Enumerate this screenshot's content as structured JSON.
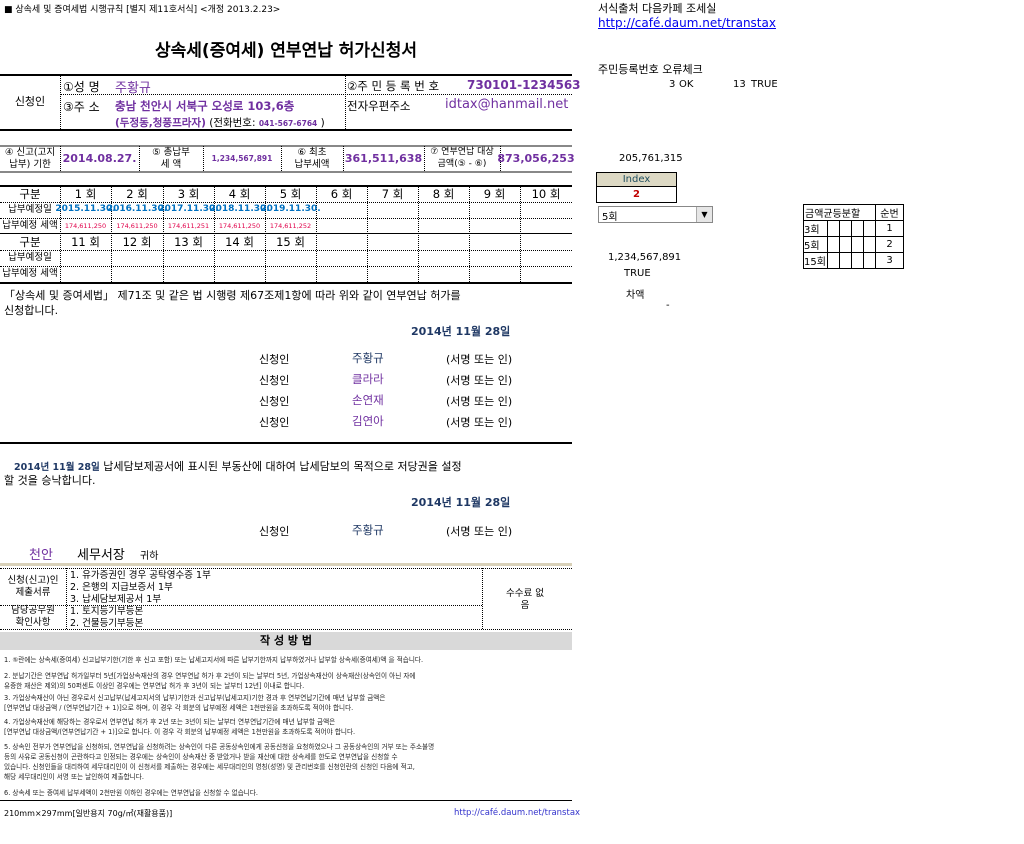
{
  "header": {
    "form_ref": "■ 상속세 및 증여세법 시행규칙 [별지 제11호서식] <개정 2013.2.23>",
    "title": "상속세(증여세) 연부연납 허가신청서"
  },
  "applicant": {
    "section_label": "신청인",
    "name_label": "①성  명",
    "name": "주황규",
    "rrn_label": "②주 민 등 록 번 호",
    "rrn": "730101-1234563",
    "address_label": "③주  소",
    "address1": "충남 천안시 서북구 오성로 103,6층",
    "address2": "(두정동,청풍프라자)",
    "phone_label_open": "(전화번호:",
    "phone": "041-567-6764",
    "phone_close": ")",
    "email_label": "전자우편주소",
    "email": "idtax@hanmail.net"
  },
  "tax": {
    "deadline_label": "④ 신고(고지 납부) 기한",
    "deadline": "2014.08.27.",
    "total_label": "⑤ 총납부 세 액",
    "total": "1,234,567,891",
    "first_label": "⑥ 최초 납부세액",
    "first": "361,511,638",
    "target_label": "⑦ 연부연납 대상금액(⑤ - ⑥)",
    "target": "873,056,253"
  },
  "schedule": {
    "gubun": "구분",
    "date_label": "납부예정일",
    "amount_label": "납부예정 세액",
    "rounds1": [
      "1 회",
      "2 회",
      "3 회",
      "4 회",
      "5 회",
      "6 회",
      "7 회",
      "8 회",
      "9 회",
      "10 회"
    ],
    "dates1": [
      "2015.11.30.",
      "2016.11.30.",
      "2017.11.30.",
      "2018.11.30.",
      "2019.11.30.",
      "",
      "",
      "",
      "",
      ""
    ],
    "amounts1": [
      "174,611,250",
      "174,611,250",
      "174,611,251",
      "174,611,250",
      "174,611,252",
      "",
      "",
      "",
      "",
      ""
    ],
    "rounds2": [
      "11 회",
      "12 회",
      "13 회",
      "14 회",
      "15 회",
      "",
      "",
      "",
      "",
      ""
    ]
  },
  "declaration": {
    "line1": "「상속세 및 증여세법」 제71조 및 같은 법 시행령 제67조제1항에 따라 위와 같이 연부연납 허가를",
    "line2": "신청합니다.",
    "date": "2014년 11월 28일",
    "signers": [
      {
        "label": "신청인",
        "name": "주황규",
        "sign": "(서명 또는 인)"
      },
      {
        "label": "신청인",
        "name": "클라라",
        "sign": "(서명 또는 인)"
      },
      {
        "label": "신청인",
        "name": "손연재",
        "sign": "(서명 또는 인)"
      },
      {
        "label": "신청인",
        "name": "김연아",
        "sign": "(서명 또는 인)"
      }
    ]
  },
  "consent": {
    "date_prefix": "2014년 11월 28일",
    "line1": "납세담보제공서에 표시된 부동산에 대하여 납세담보의 목적으로 저당권을 설정",
    "line2": "할 것을 승낙합니다.",
    "date": "2014년 11월 28일",
    "signer_label": "신청인",
    "signer": "주황규",
    "sign": "(서명 또는 인)"
  },
  "recipient": {
    "city": "천안",
    "office": "세무서장",
    "suffix": "귀하"
  },
  "documents": {
    "submit_label": "신청(신고)인 제출서류",
    "submit_items": [
      "1. 유가증권인 경우 공탁영수증 1부",
      "2. 은행의 지급보증서 1부",
      "3. 납세담보제공서 1부"
    ],
    "check_label": "담당공무원 확인사항",
    "check_items": [
      "1. 토지등기부등본",
      "2. 건물등기부등본"
    ],
    "fee": "수수료 없음"
  },
  "instructions": {
    "title": "작 성 방 법",
    "lines": [
      "1. ⑤란에는 상속세(증여세) 신고납부기한(기한 후 신고 포함) 또는 납세고지서에 따른 납부기한까지 납부하였거나 납부할 상속세(증여세)액 을 적습니다.",
      "2. 분납기간은 연부연납 허가일부터 5년[가업상속재산의 경우 연부연납 허가 후 2년이 되는 날부터 5년, 가업상속재산이 상속재산(상속인이 아닌 자에",
      "    유증한 재산은 제외)의 50퍼센트 이상인 경우에는 연부연납 허가 후 3년이 되는 날부터 12년] 이내로 합니다.",
      "3. 가업상속재산이 아닌 경우로서 신고납부(납세고지서의 납부)기한과 신고납부(납세고지)기한 경과 후 연부연납기간에 매년 납부할 금액은",
      "    [연부연납 대상금액 / (연부연납기간 + 1)]으로 하며, 이 경우 각 회분의 납부예정 세액은 1천만원을 초과하도록 적어야 합니다.",
      "4. 가업상속재산에 해당하는 경우로서 연부연납 허가 후 2년 또는 3년이 되는 날부터 연부연납기간에 매년 납부할 금액은",
      "    [연부연납 대상금액/(연부연납기간 + 1)]으로 합니다. 이 경우 각 회분의 납부예정 세액은 1천만원을 초과하도록 적어야 합니다.",
      "5. 상속인 전부가 연부연납을 신청하되, 연부연납을 신청하려는 상속인이 다른 공동상속인에게 공동신청을 요청하였으나 그 공동상속인의 거부 또는 주소불명",
      "    등의 사유로 공동신청이 곤란하다고 인정되는 경우에는 상속인이 상속재산 중 받았거나 받을 재산에 대한 상속세를 한도로 연부연납을 신청할 수",
      "    있습니다. 신청인들을 대리하여 세무대리인이 이 신청서를 제출하는 경우에는 세무대리인의 명칭(성명) 및 관리번호를 신청인란의 신청인 다음에 적고,",
      "    해당 세무대리인이 서명 또는 날인하여 제출합니다.",
      "6. 상속세 또는 증여세 납부세액이 2천만원 이하인 경우에는 연부연납을 신청할 수 없습니다."
    ]
  },
  "footer": {
    "paper": "210mm×297mm[일반용지 70g/㎡(재활용품)]",
    "link": "http://café.daum.net/transtax"
  },
  "side": {
    "source": "서식출처 다음카페 조세실",
    "link": "http://café.daum.net/transtax",
    "rrn_check_title": "주민등록번호 오류체크",
    "check_num": "3",
    "check_ok": "OK",
    "check_num2": "13",
    "check_true": "TRUE",
    "value1": "205,761,315",
    "index_header": "Index",
    "index_value": "2",
    "dropdown_value": "5회",
    "value2": "1,234,567,891",
    "value3": "TRUE",
    "diff_label": "차액",
    "diff_value": "-",
    "split_table": {
      "header1": "금액균등분할",
      "header2": "순번",
      "rows": [
        {
          "label": "3회",
          "num": "1"
        },
        {
          "label": "5회",
          "num": "2"
        },
        {
          "label": "15회",
          "num": "3"
        }
      ]
    }
  }
}
